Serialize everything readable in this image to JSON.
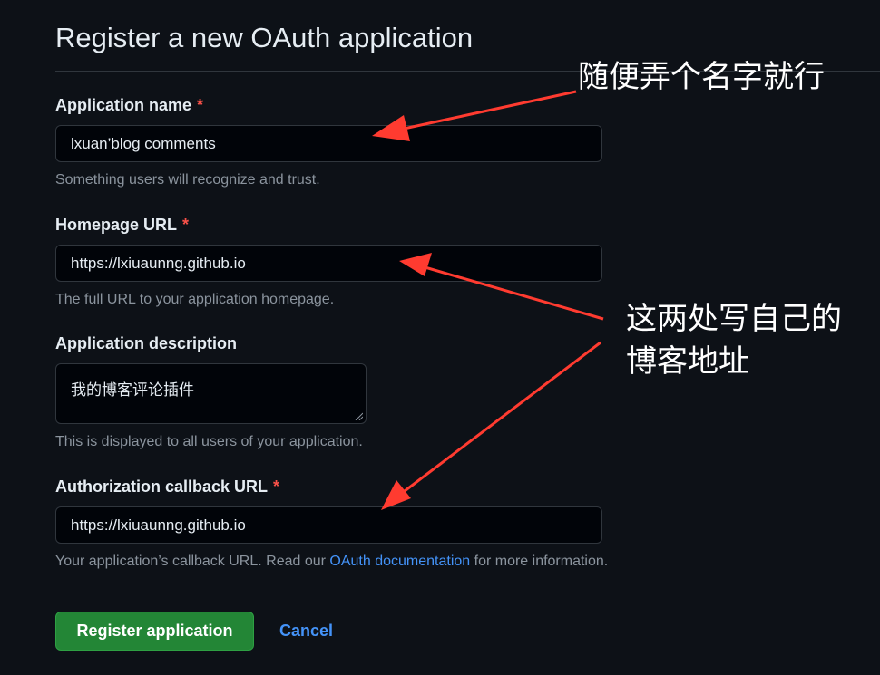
{
  "page": {
    "title": "Register a new OAuth application"
  },
  "form": {
    "app_name": {
      "label": "Application name",
      "required_mark": "*",
      "value": "lxuan’blog comments",
      "help": "Something users will recognize and trust."
    },
    "homepage_url": {
      "label": "Homepage URL",
      "required_mark": "*",
      "value": "https://lxiuaunng.github.io",
      "help": "The full URL to your application homepage."
    },
    "description": {
      "label": "Application description",
      "value": "我的博客评论插件",
      "help": "This is displayed to all users of your application."
    },
    "callback_url": {
      "label": "Authorization callback URL",
      "required_mark": "*",
      "value": "https://lxiuaunng.github.io",
      "help_before": "Your application’s callback URL. Read our ",
      "help_link": "OAuth documentation",
      "help_after": " for more information."
    }
  },
  "actions": {
    "register_label": "Register application",
    "cancel_label": "Cancel"
  },
  "annotations": {
    "name_note": "随便弄个名字就行",
    "url_note_line1": "这两处写自己的",
    "url_note_line2": "博客地址",
    "arrow_color": "#ff3b30"
  },
  "colors": {
    "background": "#0d1117",
    "primary_button": "#238636",
    "link": "#4493f8",
    "required": "#f85149"
  }
}
